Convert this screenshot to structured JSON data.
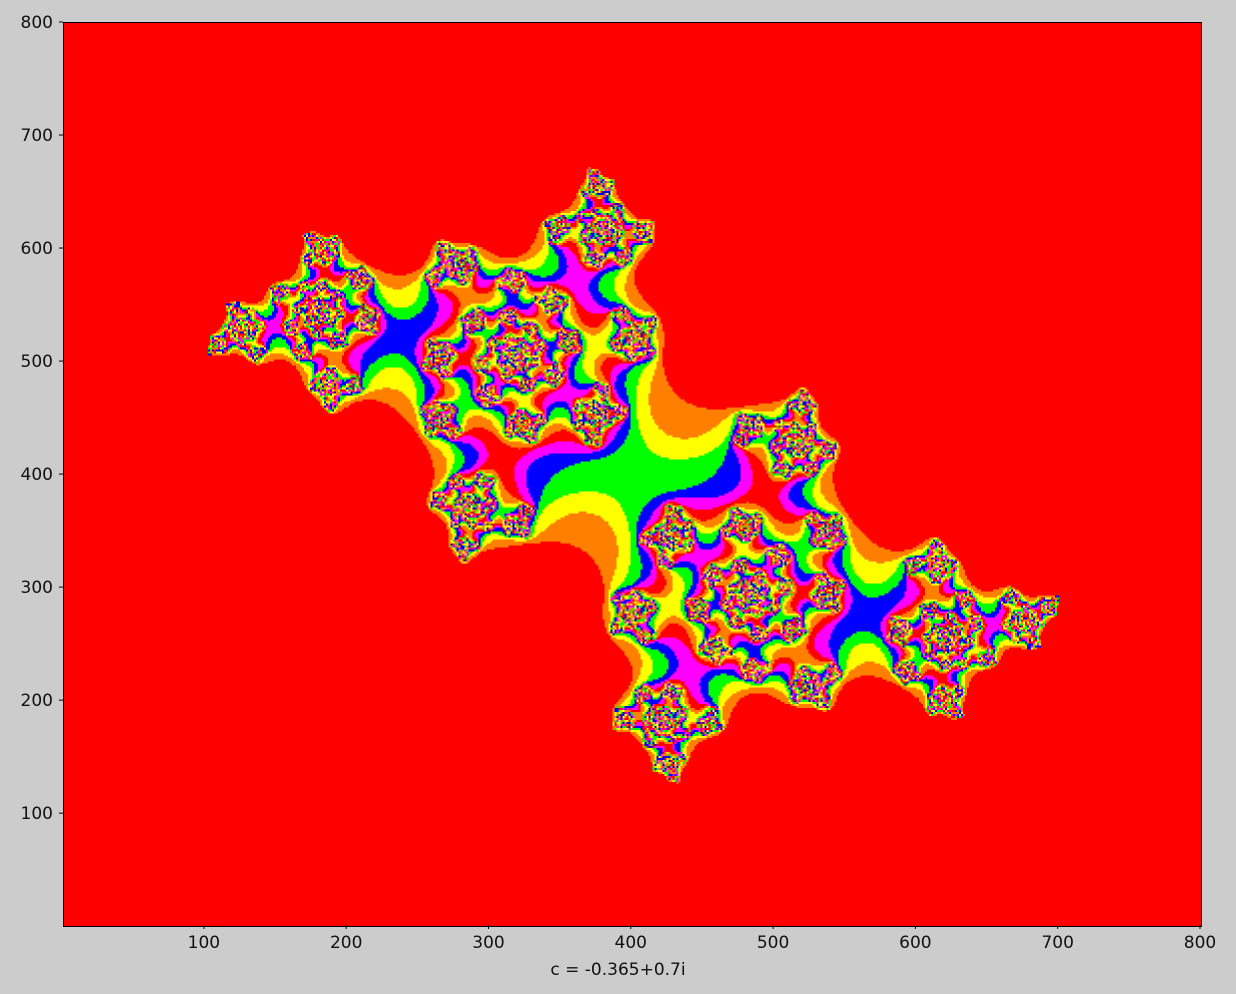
{
  "chart_data": {
    "type": "heatmap",
    "title": "",
    "xlabel": "c = -0.365+0.7i",
    "ylabel": "",
    "xlim": [
      1,
      800
    ],
    "ylim": [
      1,
      800
    ],
    "xticks": [
      100,
      200,
      300,
      400,
      500,
      600,
      700,
      800
    ],
    "yticks": [
      100,
      200,
      300,
      400,
      500,
      600,
      700,
      800
    ],
    "grid": false,
    "legend": "none",
    "julia_parameter": {
      "real": -0.365,
      "imag": 0.7
    },
    "colormap": [
      "#ff0000",
      "#ff8000",
      "#ffff00",
      "#00ff00",
      "#0000ff",
      "#ff00ff"
    ],
    "background_color": "#ff0000"
  }
}
